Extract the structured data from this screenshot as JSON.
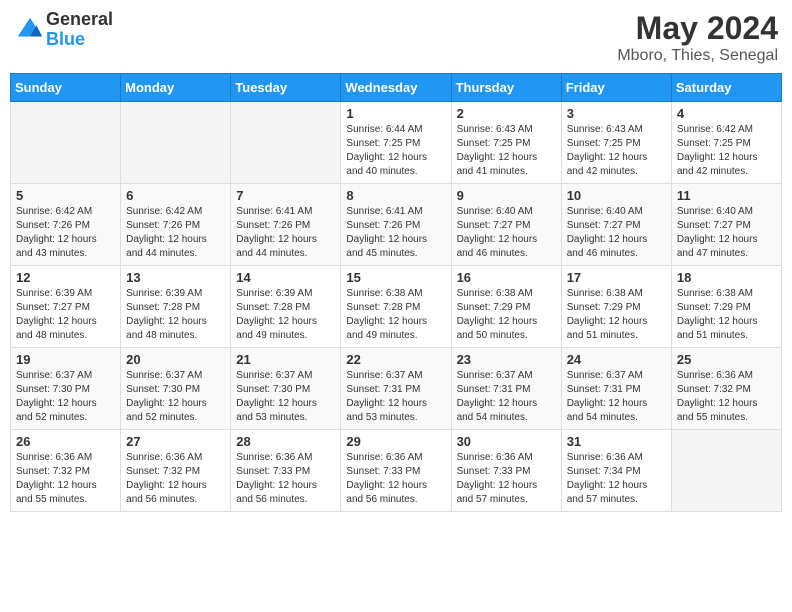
{
  "header": {
    "logo_general": "General",
    "logo_blue": "Blue",
    "month_year": "May 2024",
    "location": "Mboro, Thies, Senegal"
  },
  "days_of_week": [
    "Sunday",
    "Monday",
    "Tuesday",
    "Wednesday",
    "Thursday",
    "Friday",
    "Saturday"
  ],
  "weeks": [
    [
      {
        "day": "",
        "info": ""
      },
      {
        "day": "",
        "info": ""
      },
      {
        "day": "",
        "info": ""
      },
      {
        "day": "1",
        "info": "Sunrise: 6:44 AM\nSunset: 7:25 PM\nDaylight: 12 hours\nand 40 minutes."
      },
      {
        "day": "2",
        "info": "Sunrise: 6:43 AM\nSunset: 7:25 PM\nDaylight: 12 hours\nand 41 minutes."
      },
      {
        "day": "3",
        "info": "Sunrise: 6:43 AM\nSunset: 7:25 PM\nDaylight: 12 hours\nand 42 minutes."
      },
      {
        "day": "4",
        "info": "Sunrise: 6:42 AM\nSunset: 7:25 PM\nDaylight: 12 hours\nand 42 minutes."
      }
    ],
    [
      {
        "day": "5",
        "info": "Sunrise: 6:42 AM\nSunset: 7:26 PM\nDaylight: 12 hours\nand 43 minutes."
      },
      {
        "day": "6",
        "info": "Sunrise: 6:42 AM\nSunset: 7:26 PM\nDaylight: 12 hours\nand 44 minutes."
      },
      {
        "day": "7",
        "info": "Sunrise: 6:41 AM\nSunset: 7:26 PM\nDaylight: 12 hours\nand 44 minutes."
      },
      {
        "day": "8",
        "info": "Sunrise: 6:41 AM\nSunset: 7:26 PM\nDaylight: 12 hours\nand 45 minutes."
      },
      {
        "day": "9",
        "info": "Sunrise: 6:40 AM\nSunset: 7:27 PM\nDaylight: 12 hours\nand 46 minutes."
      },
      {
        "day": "10",
        "info": "Sunrise: 6:40 AM\nSunset: 7:27 PM\nDaylight: 12 hours\nand 46 minutes."
      },
      {
        "day": "11",
        "info": "Sunrise: 6:40 AM\nSunset: 7:27 PM\nDaylight: 12 hours\nand 47 minutes."
      }
    ],
    [
      {
        "day": "12",
        "info": "Sunrise: 6:39 AM\nSunset: 7:27 PM\nDaylight: 12 hours\nand 48 minutes."
      },
      {
        "day": "13",
        "info": "Sunrise: 6:39 AM\nSunset: 7:28 PM\nDaylight: 12 hours\nand 48 minutes."
      },
      {
        "day": "14",
        "info": "Sunrise: 6:39 AM\nSunset: 7:28 PM\nDaylight: 12 hours\nand 49 minutes."
      },
      {
        "day": "15",
        "info": "Sunrise: 6:38 AM\nSunset: 7:28 PM\nDaylight: 12 hours\nand 49 minutes."
      },
      {
        "day": "16",
        "info": "Sunrise: 6:38 AM\nSunset: 7:29 PM\nDaylight: 12 hours\nand 50 minutes."
      },
      {
        "day": "17",
        "info": "Sunrise: 6:38 AM\nSunset: 7:29 PM\nDaylight: 12 hours\nand 51 minutes."
      },
      {
        "day": "18",
        "info": "Sunrise: 6:38 AM\nSunset: 7:29 PM\nDaylight: 12 hours\nand 51 minutes."
      }
    ],
    [
      {
        "day": "19",
        "info": "Sunrise: 6:37 AM\nSunset: 7:30 PM\nDaylight: 12 hours\nand 52 minutes."
      },
      {
        "day": "20",
        "info": "Sunrise: 6:37 AM\nSunset: 7:30 PM\nDaylight: 12 hours\nand 52 minutes."
      },
      {
        "day": "21",
        "info": "Sunrise: 6:37 AM\nSunset: 7:30 PM\nDaylight: 12 hours\nand 53 minutes."
      },
      {
        "day": "22",
        "info": "Sunrise: 6:37 AM\nSunset: 7:31 PM\nDaylight: 12 hours\nand 53 minutes."
      },
      {
        "day": "23",
        "info": "Sunrise: 6:37 AM\nSunset: 7:31 PM\nDaylight: 12 hours\nand 54 minutes."
      },
      {
        "day": "24",
        "info": "Sunrise: 6:37 AM\nSunset: 7:31 PM\nDaylight: 12 hours\nand 54 minutes."
      },
      {
        "day": "25",
        "info": "Sunrise: 6:36 AM\nSunset: 7:32 PM\nDaylight: 12 hours\nand 55 minutes."
      }
    ],
    [
      {
        "day": "26",
        "info": "Sunrise: 6:36 AM\nSunset: 7:32 PM\nDaylight: 12 hours\nand 55 minutes."
      },
      {
        "day": "27",
        "info": "Sunrise: 6:36 AM\nSunset: 7:32 PM\nDaylight: 12 hours\nand 56 minutes."
      },
      {
        "day": "28",
        "info": "Sunrise: 6:36 AM\nSunset: 7:33 PM\nDaylight: 12 hours\nand 56 minutes."
      },
      {
        "day": "29",
        "info": "Sunrise: 6:36 AM\nSunset: 7:33 PM\nDaylight: 12 hours\nand 56 minutes."
      },
      {
        "day": "30",
        "info": "Sunrise: 6:36 AM\nSunset: 7:33 PM\nDaylight: 12 hours\nand 57 minutes."
      },
      {
        "day": "31",
        "info": "Sunrise: 6:36 AM\nSunset: 7:34 PM\nDaylight: 12 hours\nand 57 minutes."
      },
      {
        "day": "",
        "info": ""
      }
    ]
  ]
}
